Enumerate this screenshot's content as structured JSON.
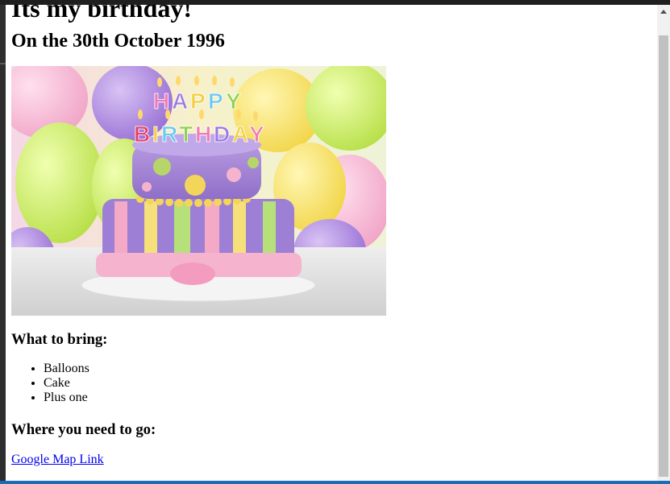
{
  "page": {
    "title": "Its my birthday!",
    "date_heading": "On the 30th October 1996",
    "image": {
      "alt": "Birthday cake",
      "banner_text": "HAPPY BIRTHDAY"
    },
    "bring_heading": "What to bring:",
    "bring_items": [
      "Balloons",
      "Cake",
      "Plus one"
    ],
    "where_heading": "Where you need to go:",
    "map_link_label": "Google Map Link"
  },
  "colors": {
    "link": "#0000ee",
    "scrollbar_thumb": "#c1c1c1",
    "scrollbar_track": "#f1f1f1",
    "bottom_bar": "#1c6bb5"
  }
}
